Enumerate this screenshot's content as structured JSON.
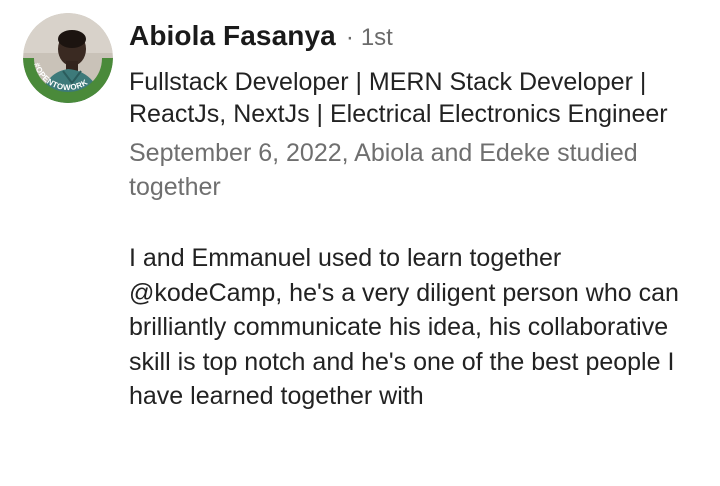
{
  "recommendation": {
    "author": {
      "name": "Abiola Fasanya",
      "separator": "·",
      "connection_degree": "1st",
      "headline": "Fullstack Developer | MERN Stack Developer | ReactJs, NextJs | Electrical Electronics Engineer",
      "avatar_badge": "#OPENTOWORK"
    },
    "meta": "September 6, 2022, Abiola and Edeke studied together",
    "text": "I and Emmanuel used to learn together @kodeCamp, he's a very diligent person who can brilliantly communicate his idea, his collaborative skill is top notch and he's one of the best people I have learned together with"
  },
  "colors": {
    "open_to_work_ring": "#4a8a3a",
    "secondary_text": "#6f6f6f"
  }
}
